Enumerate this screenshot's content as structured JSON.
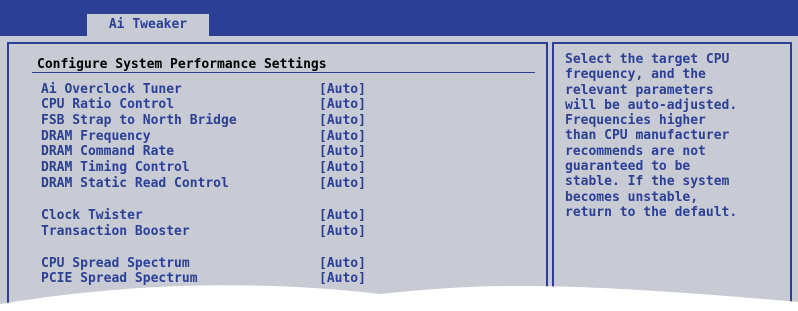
{
  "tab": {
    "label": "Ai Tweaker"
  },
  "section_title": "Configure System Performance Settings",
  "settings": [
    {
      "label": "Ai Overclock Tuner",
      "value": "[Auto]"
    },
    {
      "label": "CPU Ratio Control",
      "value": "[Auto]"
    },
    {
      "label": "FSB Strap to North Bridge",
      "value": "[Auto]"
    },
    {
      "label": "DRAM Frequency",
      "value": "[Auto]"
    },
    {
      "label": "DRAM Command Rate",
      "value": "[Auto]"
    },
    {
      "label": "DRAM Timing Control",
      "value": "[Auto]"
    },
    {
      "label": "DRAM Static Read Control",
      "value": "[Auto]"
    },
    {
      "label": "Clock Twister",
      "value": "[Auto]"
    },
    {
      "label": "Transaction Booster",
      "value": "[Auto]"
    },
    {
      "label": "CPU Spread Spectrum",
      "value": "[Auto]"
    },
    {
      "label": "PCIE Spread Spectrum",
      "value": "[Auto]"
    }
  ],
  "help_text": "Select the target CPU\nfrequency, and the\nrelevant parameters\nwill be auto-adjusted.\nFrequencies higher\nthan CPU manufacturer\nrecommends are not\nguaranteed to be\nstable. If the system\nbecomes unstable,\nreturn to the default.",
  "colors": {
    "bar": "#2b3f95",
    "panel": "#c8cbd4",
    "text": "#2b3f95",
    "heading": "#000000"
  }
}
